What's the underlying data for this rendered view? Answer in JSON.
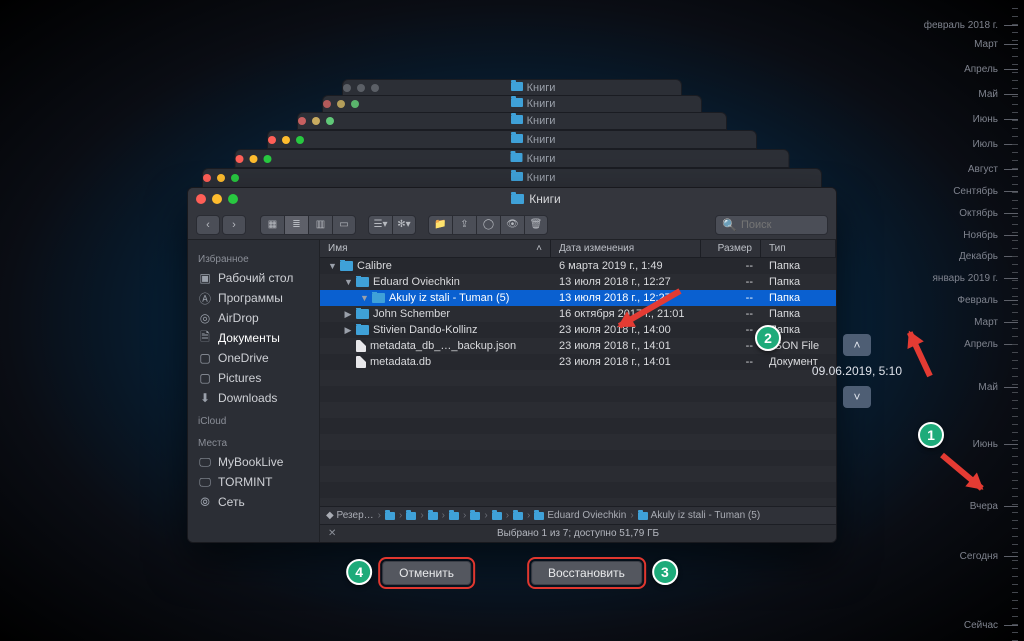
{
  "window_title": "Книги",
  "search": {
    "placeholder": "Поиск"
  },
  "sidebar": {
    "sections": [
      {
        "title": "Избранное",
        "items": [
          {
            "label": "Рабочий стол",
            "icon": "desktop-icon"
          },
          {
            "label": "Программы",
            "icon": "apps-icon"
          },
          {
            "label": "AirDrop",
            "icon": "airdrop-icon"
          },
          {
            "label": "Документы",
            "icon": "documents-icon",
            "active": true
          },
          {
            "label": "OneDrive",
            "icon": "folder-icon"
          },
          {
            "label": "Pictures",
            "icon": "folder-icon"
          },
          {
            "label": "Downloads",
            "icon": "downloads-icon"
          }
        ]
      },
      {
        "title": "iCloud",
        "items": []
      },
      {
        "title": "Места",
        "items": [
          {
            "label": "MyBookLive",
            "icon": "display-icon"
          },
          {
            "label": "TORMINT",
            "icon": "display-icon"
          },
          {
            "label": "Сеть",
            "icon": "globe-icon"
          }
        ]
      }
    ]
  },
  "columns": {
    "name": "Имя",
    "date": "Дата изменения",
    "size": "Размер",
    "kind": "Тип"
  },
  "rows": [
    {
      "indent": 0,
      "disclose": "▼",
      "icon": "folder",
      "name": "Calibre",
      "date": "6 марта 2019 г., 1:49",
      "size": "--",
      "kind": "Папка"
    },
    {
      "indent": 1,
      "disclose": "▼",
      "icon": "folder",
      "name": "Eduard Oviechkin",
      "date": "13 июля 2018 г., 12:27",
      "size": "--",
      "kind": "Папка"
    },
    {
      "indent": 2,
      "disclose": "▼",
      "icon": "folder",
      "name": "Akuly iz stali - Tuman (5)",
      "date": "13 июля 2018 г., 12:27",
      "size": "--",
      "kind": "Папка",
      "selected": true
    },
    {
      "indent": 1,
      "disclose": "▶",
      "icon": "folder",
      "name": "John Schember",
      "date": "16 октября 2017 г., 21:01",
      "size": "--",
      "kind": "Папка"
    },
    {
      "indent": 1,
      "disclose": "▶",
      "icon": "folder",
      "name": "Stivien Dando-Kollinz",
      "date": "23 июля 2018 г., 14:00",
      "size": "--",
      "kind": "Папка"
    },
    {
      "indent": 1,
      "disclose": "",
      "icon": "doc",
      "name": "metadata_db_…_backup.json",
      "date": "23 июля 2018 г., 14:01",
      "size": "--",
      "kind": "JSON File"
    },
    {
      "indent": 1,
      "disclose": "",
      "icon": "doc",
      "name": "metadata.db",
      "date": "23 июля 2018 г., 14:01",
      "size": "--",
      "kind": "Документ"
    }
  ],
  "pathbar": [
    "Резер…",
    "",
    "",
    "",
    "",
    "",
    "",
    "",
    "Eduard Oviechkin",
    "Akuly iz stali - Tuman (5)"
  ],
  "status": "Выбрано 1 из 7; доступно 51,79 ГБ",
  "snapshot_date": "09.06.2019, 5:10",
  "buttons": {
    "cancel": "Отменить",
    "restore": "Восстановить"
  },
  "timeline": [
    {
      "label": "февраль 2018 г.",
      "pct": 2
    },
    {
      "label": "Март",
      "pct": 5
    },
    {
      "label": "Апрель",
      "pct": 9
    },
    {
      "label": "Май",
      "pct": 13
    },
    {
      "label": "Июнь",
      "pct": 17
    },
    {
      "label": "Июль",
      "pct": 21
    },
    {
      "label": "Август",
      "pct": 25
    },
    {
      "label": "Сентябрь",
      "pct": 28.5
    },
    {
      "label": "Октябрь",
      "pct": 32
    },
    {
      "label": "Ноябрь",
      "pct": 35.5
    },
    {
      "label": "Декабрь",
      "pct": 39
    },
    {
      "label": "январь 2019 г.",
      "pct": 42.5
    },
    {
      "label": "Февраль",
      "pct": 46
    },
    {
      "label": "Март",
      "pct": 49.5
    },
    {
      "label": "Апрель",
      "pct": 53
    },
    {
      "label": "Май",
      "pct": 60
    },
    {
      "label": "Июнь",
      "pct": 69
    },
    {
      "label": "Вчера",
      "pct": 79
    },
    {
      "label": "Сегодня",
      "pct": 87
    },
    {
      "label": "Сейчас",
      "pct": 98
    }
  ],
  "badges": {
    "b1": "1",
    "b2": "2",
    "b3": "3",
    "b4": "4"
  },
  "ghost_title": "Книги"
}
